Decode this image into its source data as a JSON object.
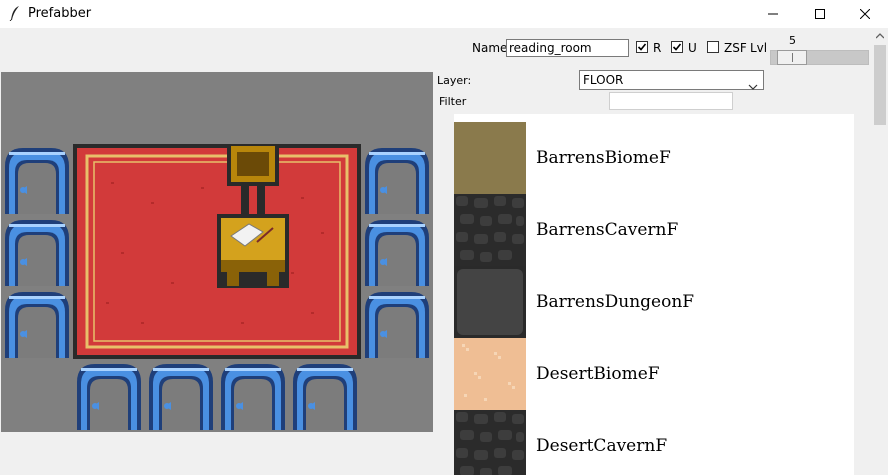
{
  "window": {
    "title": "Prefabber",
    "icon": "feather-icon",
    "controls": [
      "minimize-icon",
      "maximize-icon",
      "close-icon"
    ]
  },
  "toolbar": {
    "name_label": "Name",
    "name_value": "reading_room",
    "checkbox_r": {
      "label": "R",
      "checked": true
    },
    "checkbox_u": {
      "label": "U",
      "checked": true
    },
    "checkbox_zsf": {
      "label": "ZSF",
      "checked": false
    },
    "lvl_label": "Lvl",
    "lvl_value": "5"
  },
  "layer": {
    "label": "Layer:",
    "selected": "FLOOR"
  },
  "filter": {
    "label": "Filter",
    "value": ""
  },
  "tiles": [
    {
      "name": "BarrensBiomeF",
      "color": "#8a7a4c"
    },
    {
      "name": "BarrensCavernF",
      "color": "#2e2e2e"
    },
    {
      "name": "BarrensDungeonF",
      "color": "#3c3c3c"
    },
    {
      "name": "DesertBiomeF",
      "color": "#efbe94"
    },
    {
      "name": "DesertCavernF",
      "color": "#2e2e2e"
    }
  ],
  "colors": {
    "canvas_bg": "#808080",
    "rug_red": "#d23a3a",
    "rug_border": "#e8c06a",
    "door_blue": "#4a90e2",
    "chair_gold": "#b8860b"
  }
}
